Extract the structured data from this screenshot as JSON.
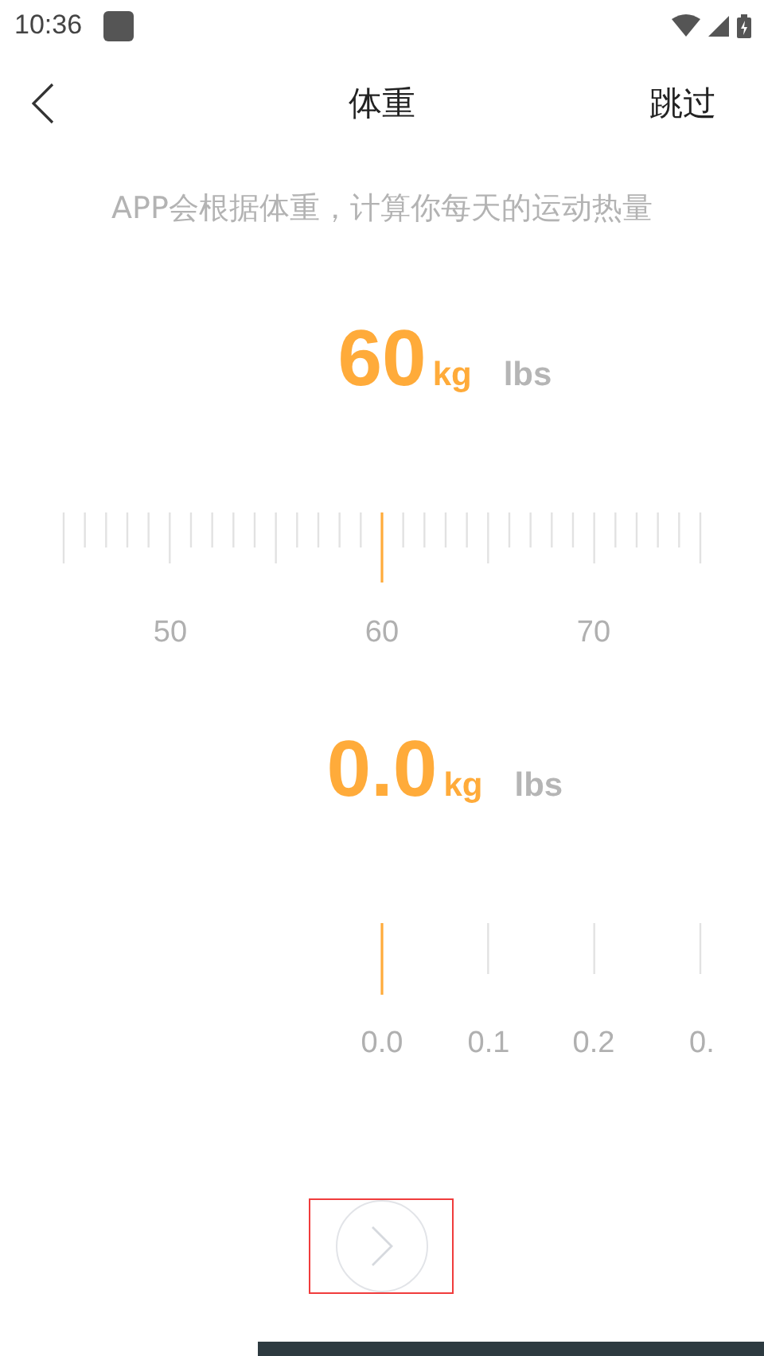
{
  "status_bar": {
    "time": "10:36"
  },
  "header": {
    "title": "体重",
    "skip": "跳过"
  },
  "subtitle": "APP会根据体重，计算你每天的运动热量",
  "pickers": [
    {
      "value": "60",
      "units": [
        {
          "label": "kg",
          "selected": true
        },
        {
          "label": "lbs",
          "selected": false
        }
      ],
      "scale_labels": [
        "50",
        "60",
        "70"
      ]
    },
    {
      "value": "0.0",
      "units": [
        {
          "label": "kg",
          "selected": true
        },
        {
          "label": "lbs",
          "selected": false
        }
      ],
      "scale_labels": [
        "0.0",
        "0.1",
        "0.2",
        "0."
      ]
    }
  ]
}
